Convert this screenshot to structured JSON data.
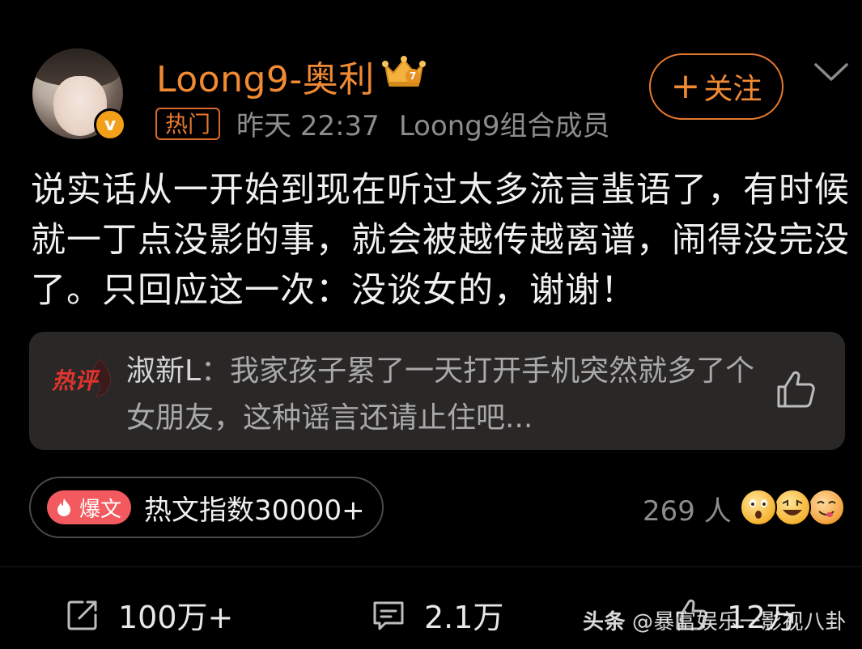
{
  "post": {
    "author": {
      "name": "Loong9-奥利",
      "verified_badge_symbol": "v",
      "crown_level": "7"
    },
    "meta": {
      "tag": "热门",
      "time": "昨天 22:37",
      "source": "Loong9组合成员"
    },
    "follow_label": "关注",
    "follow_plus": "+",
    "content": "说实话从一开始到现在听过太多流言蜚语了，有时候就一丁点没影的事，就会被越传越离谱，闹得没完没了。只回应这一次：没谈女的，谢谢！",
    "hot_comment": {
      "badge_text": "热评",
      "author": "淑新L",
      "separator": "：",
      "text": "我家孩子累了一天打开手机突然就多了个女朋友，这种谣言还请止住吧..."
    },
    "hot_index": {
      "badge": "爆文",
      "text": "热文指数30000+"
    },
    "reactions": {
      "count_text": "269 人"
    },
    "actions": {
      "repost": "100万+",
      "comment": "2.1万",
      "like": "12万"
    }
  },
  "watermark": {
    "brand": "头条",
    "account": "@暴富娱乐一影视八卦"
  },
  "colors": {
    "background": "#000000",
    "accent_orange": "#f08a33",
    "comment_card_bg": "#2a2727",
    "baowen_red": "#f25a5f",
    "secondary_text": "#8c8c8c"
  },
  "icons": {
    "crown": "crown-icon",
    "dropdown": "chevron-down-icon",
    "like": "thumbs-up-icon",
    "repost": "repost-icon",
    "comment": "comment-icon",
    "flame": "flame-icon"
  }
}
